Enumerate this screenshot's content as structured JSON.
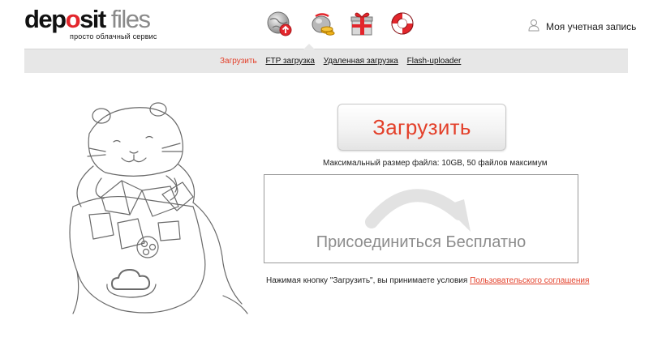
{
  "logo": {
    "part1": "dep",
    "part2": "o",
    "part3": "sit",
    "part4": " files",
    "tagline": "просто облачный сервис"
  },
  "nav_icons": [
    {
      "name": "globe-upload-icon"
    },
    {
      "name": "gold-piggy-icon"
    },
    {
      "name": "gift-icon"
    },
    {
      "name": "lifebuoy-icon"
    }
  ],
  "account": {
    "label": "Моя учетная запись"
  },
  "subnav": {
    "links": [
      {
        "label": "Загрузить",
        "active": true
      },
      {
        "label": "FTP загрузка",
        "active": false
      },
      {
        "label": "Удаленная загрузка",
        "active": false
      },
      {
        "label": "Flash-uploader",
        "active": false
      }
    ]
  },
  "upload": {
    "button_label": "Загрузить"
  },
  "max_size_text": "Максимальный размер файла: 10GB, 50 файлов максимум",
  "join": {
    "label": "Присоединиться Бесплатно"
  },
  "terms": {
    "prefix": "Нажимая кнопку \"Загрузить\", вы принимаете условия ",
    "link": "Пользовательского соглашения"
  },
  "colors": {
    "accent": "#e3402a",
    "subnav_bg": "#e7e7e7"
  }
}
